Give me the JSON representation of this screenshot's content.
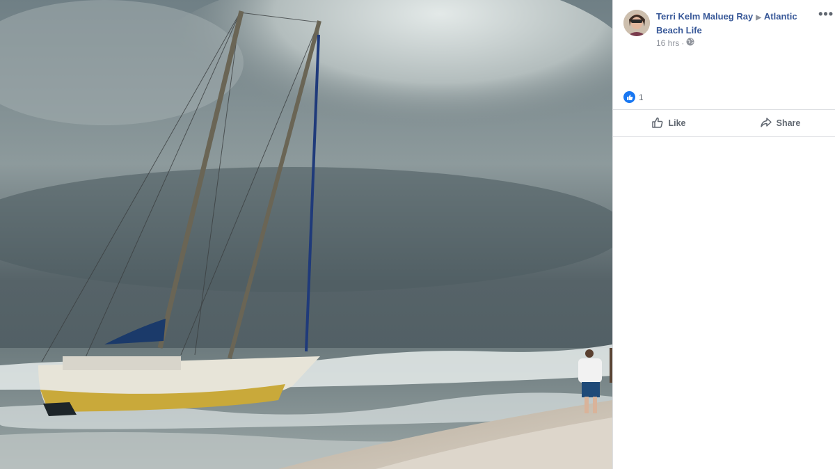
{
  "post": {
    "author": "Terri Kelm Malueg Ray",
    "group": "Atlantic Beach Life",
    "time": "16 hrs",
    "audience_icon": "globe-icon",
    "more_icon": "more-options-icon"
  },
  "reactions": {
    "icon": "like-reaction-icon",
    "count": "1"
  },
  "actions": {
    "like_label": "Like",
    "share_label": "Share"
  },
  "photo": {
    "subject": "beached-sailboat-photo"
  },
  "colors": {
    "link": "#385898",
    "muted": "#90949c",
    "like_blue": "#1877f2",
    "divider": "#dddfe2"
  }
}
